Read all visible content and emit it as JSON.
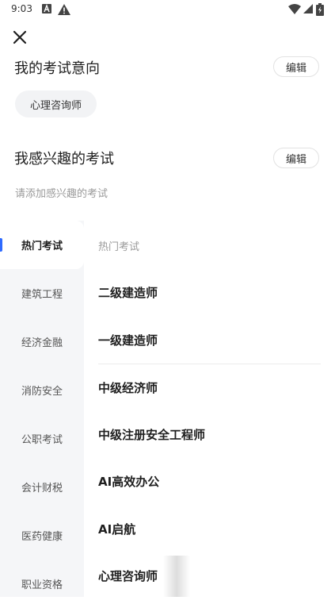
{
  "status_bar": {
    "time": "9:03"
  },
  "intent": {
    "title": "我的考试意向",
    "edit_label": "编辑",
    "chips": [
      "心理咨询师"
    ]
  },
  "interest": {
    "title": "我感兴趣的考试",
    "edit_label": "编辑",
    "hint": "请添加感兴趣的考试"
  },
  "categories": {
    "items": [
      "热门考试",
      "建筑工程",
      "经济金融",
      "消防安全",
      "公职考试",
      "会计财税",
      "医药健康",
      "职业资格"
    ],
    "active": "热门考试"
  },
  "exam_list": {
    "header": "热门考试",
    "items": [
      "二级建造师",
      "一级建造师",
      "中级经济师",
      "中级注册安全工程师",
      "AI高效办公",
      "AI启航",
      "心理咨询师"
    ]
  },
  "colors": {
    "accent": "#2f6bff",
    "sidebar_bg": "#f5f6f8"
  }
}
